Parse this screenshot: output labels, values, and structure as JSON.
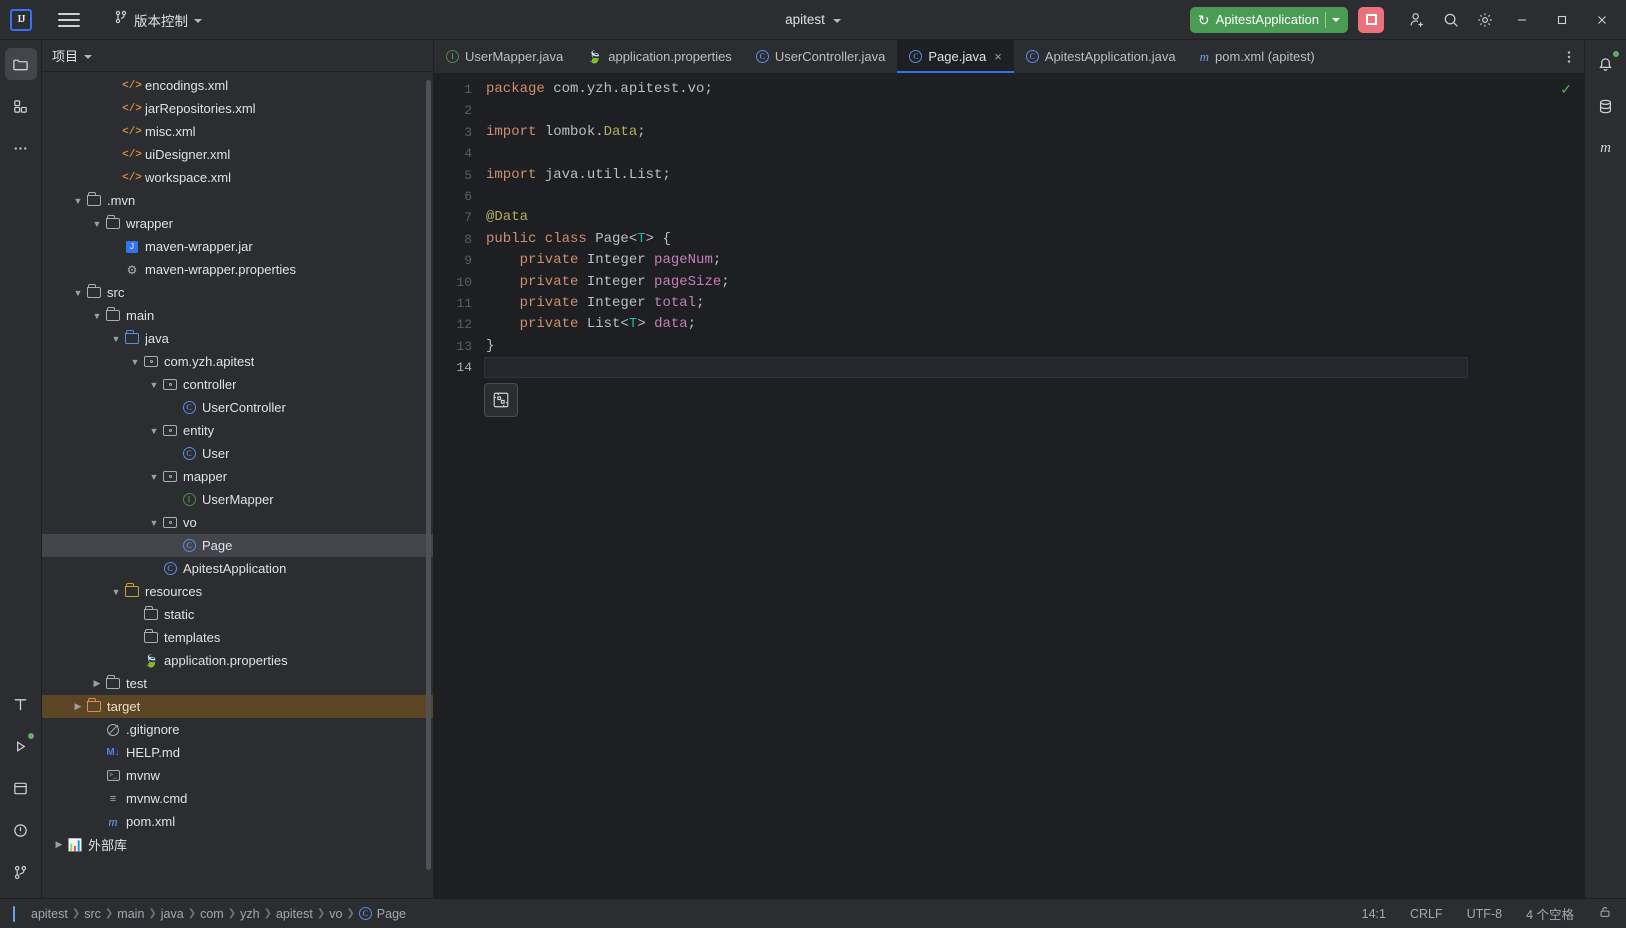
{
  "titlebar": {
    "logo": "IJ",
    "menu_icon": "hamburger-icon",
    "vcs_icon": "branch-icon",
    "vcs_label": "版本控制",
    "project_name": "apitest",
    "run_config": {
      "icon": "rerun-icon",
      "name": "ApitestApplication",
      "dropdown_icon": "chevron-down-icon"
    },
    "stop_label": "stop-icon",
    "icons": [
      "add-user-icon",
      "search-icon",
      "gear-icon"
    ],
    "window_controls": [
      "minimize",
      "maximize",
      "close"
    ]
  },
  "left_rail": {
    "items": [
      {
        "name": "project-tool-window",
        "icon": "folder-icon",
        "active": true
      },
      {
        "name": "structure-tool-window",
        "icon": "structure-icon",
        "active": false
      },
      {
        "name": "more-tool-windows",
        "icon": "ellipsis-icon",
        "active": false
      }
    ],
    "bottom_items": [
      {
        "name": "terminal-tool-window",
        "icon": "terminal-T-icon"
      },
      {
        "name": "run-tool-window",
        "icon": "run-triangle-icon",
        "badge": true
      },
      {
        "name": "services-tool-window",
        "icon": "services-icon"
      },
      {
        "name": "problems-tool-window",
        "icon": "problems-icon"
      },
      {
        "name": "git-tool-window",
        "icon": "branch-icon"
      }
    ]
  },
  "right_rail": {
    "items": [
      {
        "name": "notifications-tool-window",
        "icon": "bell-icon",
        "badge": true
      },
      {
        "name": "database-tool-window",
        "icon": "database-icon"
      },
      {
        "name": "maven-tool-window",
        "icon": "maven-m-icon"
      }
    ]
  },
  "project_panel": {
    "title": "项目",
    "title_chevron": "chevron-down-icon",
    "tree": [
      {
        "label": "encodings.xml",
        "indent": 3,
        "icon": "xml-file-icon",
        "arrow": ""
      },
      {
        "label": "jarRepositories.xml",
        "indent": 3,
        "icon": "xml-file-icon",
        "arrow": ""
      },
      {
        "label": "misc.xml",
        "indent": 3,
        "icon": "xml-file-icon",
        "arrow": ""
      },
      {
        "label": "uiDesigner.xml",
        "indent": 3,
        "icon": "xml-file-icon",
        "arrow": ""
      },
      {
        "label": "workspace.xml",
        "indent": 3,
        "icon": "xml-file-icon",
        "arrow": ""
      },
      {
        "label": ".mvn",
        "indent": 1,
        "icon": "folder-icon",
        "arrow": "expanded"
      },
      {
        "label": "wrapper",
        "indent": 2,
        "icon": "folder-icon",
        "arrow": "expanded"
      },
      {
        "label": "maven-wrapper.jar",
        "indent": 3,
        "icon": "jar-file-icon",
        "arrow": ""
      },
      {
        "label": "maven-wrapper.properties",
        "indent": 3,
        "icon": "properties-file-icon",
        "arrow": ""
      },
      {
        "label": "src",
        "indent": 1,
        "icon": "folder-icon",
        "arrow": "expanded"
      },
      {
        "label": "main",
        "indent": 2,
        "icon": "folder-icon",
        "arrow": "expanded"
      },
      {
        "label": "java",
        "indent": 3,
        "icon": "source-folder-icon",
        "arrow": "expanded"
      },
      {
        "label": "com.yzh.apitest",
        "indent": 4,
        "icon": "package-icon",
        "arrow": "expanded"
      },
      {
        "label": "controller",
        "indent": 5,
        "icon": "package-icon",
        "arrow": "expanded"
      },
      {
        "label": "UserController",
        "indent": 6,
        "icon": "java-class-icon",
        "arrow": ""
      },
      {
        "label": "entity",
        "indent": 5,
        "icon": "package-icon",
        "arrow": "expanded"
      },
      {
        "label": "User",
        "indent": 6,
        "icon": "java-class-icon",
        "arrow": ""
      },
      {
        "label": "mapper",
        "indent": 5,
        "icon": "package-icon",
        "arrow": "expanded"
      },
      {
        "label": "UserMapper",
        "indent": 6,
        "icon": "java-interface-icon",
        "arrow": ""
      },
      {
        "label": "vo",
        "indent": 5,
        "icon": "package-icon",
        "arrow": "expanded"
      },
      {
        "label": "Page",
        "indent": 6,
        "icon": "java-class-icon",
        "arrow": "",
        "selected": true
      },
      {
        "label": "ApitestApplication",
        "indent": 5,
        "icon": "spring-class-icon",
        "arrow": ""
      },
      {
        "label": "resources",
        "indent": 3,
        "icon": "resources-folder-icon",
        "arrow": "expanded"
      },
      {
        "label": "static",
        "indent": 4,
        "icon": "folder-icon",
        "arrow": ""
      },
      {
        "label": "templates",
        "indent": 4,
        "icon": "folder-icon",
        "arrow": ""
      },
      {
        "label": "application.properties",
        "indent": 4,
        "icon": "spring-properties-icon",
        "arrow": ""
      },
      {
        "label": "test",
        "indent": 2,
        "icon": "folder-icon",
        "arrow": "collapsed"
      },
      {
        "label": "target",
        "indent": 1,
        "icon": "excluded-folder-icon",
        "arrow": "collapsed",
        "excluded_selected": true
      },
      {
        "label": ".gitignore",
        "indent": 2,
        "icon": "ignored-file-icon",
        "arrow": ""
      },
      {
        "label": "HELP.md",
        "indent": 2,
        "icon": "markdown-file-icon",
        "arrow": ""
      },
      {
        "label": "mvnw",
        "indent": 2,
        "icon": "shell-file-icon",
        "arrow": ""
      },
      {
        "label": "mvnw.cmd",
        "indent": 2,
        "icon": "text-file-icon",
        "arrow": ""
      },
      {
        "label": "pom.xml",
        "indent": 2,
        "icon": "maven-file-icon",
        "arrow": ""
      },
      {
        "label": "外部库",
        "indent": 0,
        "icon": "library-icon",
        "arrow": "collapsed"
      }
    ]
  },
  "editor": {
    "tabs": [
      {
        "label": "UserMapper.java",
        "icon": "java-interface-icon",
        "active": false,
        "closable": false
      },
      {
        "label": "application.properties",
        "icon": "spring-properties-icon",
        "active": false,
        "closable": false
      },
      {
        "label": "UserController.java",
        "icon": "java-class-icon",
        "active": false,
        "closable": false
      },
      {
        "label": "Page.java",
        "icon": "java-class-icon",
        "active": true,
        "closable": true
      },
      {
        "label": "ApitestApplication.java",
        "icon": "spring-class-icon",
        "active": false,
        "closable": false
      },
      {
        "label": "pom.xml (apitest)",
        "icon": "maven-file-icon",
        "active": false,
        "closable": false
      }
    ],
    "more_icon": "vertical-ellipsis-icon",
    "inspection_status": "check-icon",
    "floating_widget": "code-with-me-icon",
    "line_numbers": [
      "1",
      "2",
      "3",
      "4",
      "5",
      "6",
      "7",
      "8",
      "9",
      "10",
      "11",
      "12",
      "13",
      "14"
    ],
    "current_line": 14,
    "code_lines": [
      {
        "n": 1,
        "tokens": [
          {
            "t": "package ",
            "c": "kw"
          },
          {
            "t": "com.yzh.apitest.vo;",
            "c": "txt"
          }
        ]
      },
      {
        "n": 2,
        "tokens": []
      },
      {
        "n": 3,
        "tokens": [
          {
            "t": "import ",
            "c": "kw"
          },
          {
            "t": "lombok.",
            "c": "txt"
          },
          {
            "t": "Data",
            "c": "ann"
          },
          {
            "t": ";",
            "c": "txt"
          }
        ]
      },
      {
        "n": 4,
        "tokens": []
      },
      {
        "n": 5,
        "tokens": [
          {
            "t": "import ",
            "c": "kw"
          },
          {
            "t": "java.util.List;",
            "c": "txt"
          }
        ]
      },
      {
        "n": 6,
        "tokens": []
      },
      {
        "n": 7,
        "tokens": [
          {
            "t": "@Data",
            "c": "ann"
          }
        ]
      },
      {
        "n": 8,
        "tokens": [
          {
            "t": "public class ",
            "c": "kw"
          },
          {
            "t": "Page<",
            "c": "cls"
          },
          {
            "t": "T",
            "c": "gen"
          },
          {
            "t": "> {",
            "c": "cls"
          }
        ]
      },
      {
        "n": 9,
        "tokens": [
          {
            "t": "    private ",
            "c": "kw"
          },
          {
            "t": "Integer ",
            "c": "type"
          },
          {
            "t": "pageNum",
            "c": "fld"
          },
          {
            "t": ";",
            "c": "txt"
          }
        ]
      },
      {
        "n": 10,
        "tokens": [
          {
            "t": "    private ",
            "c": "kw"
          },
          {
            "t": "Integer ",
            "c": "type"
          },
          {
            "t": "pageSize",
            "c": "fld"
          },
          {
            "t": ";",
            "c": "txt"
          }
        ]
      },
      {
        "n": 11,
        "tokens": [
          {
            "t": "    private ",
            "c": "kw"
          },
          {
            "t": "Integer ",
            "c": "type"
          },
          {
            "t": "total",
            "c": "fld"
          },
          {
            "t": ";",
            "c": "txt"
          }
        ]
      },
      {
        "n": 12,
        "tokens": [
          {
            "t": "    private ",
            "c": "kw"
          },
          {
            "t": "List<",
            "c": "type"
          },
          {
            "t": "T",
            "c": "gen"
          },
          {
            "t": "> ",
            "c": "type"
          },
          {
            "t": "data",
            "c": "fld"
          },
          {
            "t": ";",
            "c": "txt"
          }
        ]
      },
      {
        "n": 13,
        "tokens": [
          {
            "t": "}",
            "c": "txt"
          }
        ]
      },
      {
        "n": 14,
        "tokens": []
      }
    ]
  },
  "statusbar": {
    "breadcrumbs": [
      {
        "label": "apitest",
        "icon": "project-icon"
      },
      {
        "label": "src",
        "icon": ""
      },
      {
        "label": "main",
        "icon": ""
      },
      {
        "label": "java",
        "icon": ""
      },
      {
        "label": "com",
        "icon": ""
      },
      {
        "label": "yzh",
        "icon": ""
      },
      {
        "label": "apitest",
        "icon": ""
      },
      {
        "label": "vo",
        "icon": ""
      },
      {
        "label": "Page",
        "icon": "java-class-icon"
      }
    ],
    "caret": "14:1",
    "line_sep": "CRLF",
    "encoding": "UTF-8",
    "indent": "4 个空格",
    "lock_icon": "unlocked-icon"
  },
  "colors": {
    "accent": "#3574f0",
    "run_green": "#4a9b54",
    "stop_red": "#e9727c",
    "panel_bg": "#2b2d30",
    "editor_bg": "#1e1f22",
    "selection": "#43454a",
    "excluded": "#5b4524"
  }
}
